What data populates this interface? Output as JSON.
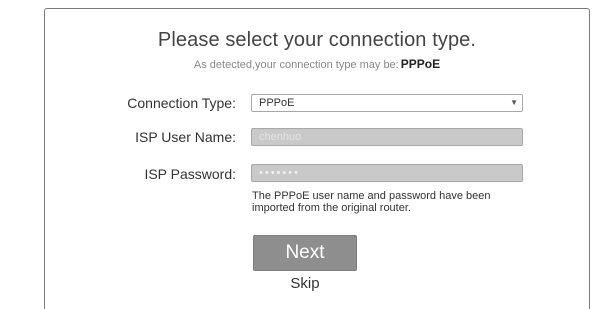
{
  "header": {
    "title": "Please select your connection type",
    "title_suffix": ".",
    "detected_prefix": "As detected,your connection type may be:",
    "detected_type": "PPPoE"
  },
  "form": {
    "connection_type_label": "Connection Type:",
    "connection_type_value": "PPPoE",
    "isp_username_label": "ISP User Name:",
    "isp_username_value": "chenhuo",
    "isp_password_label": "ISP Password:",
    "isp_password_value": "•••••••"
  },
  "note": "The PPPoE user name and password have been imported from the original router.",
  "actions": {
    "next_label": "Next",
    "skip_label": "Skip"
  },
  "icons": {
    "dropdown": "chevron-down-icon"
  }
}
